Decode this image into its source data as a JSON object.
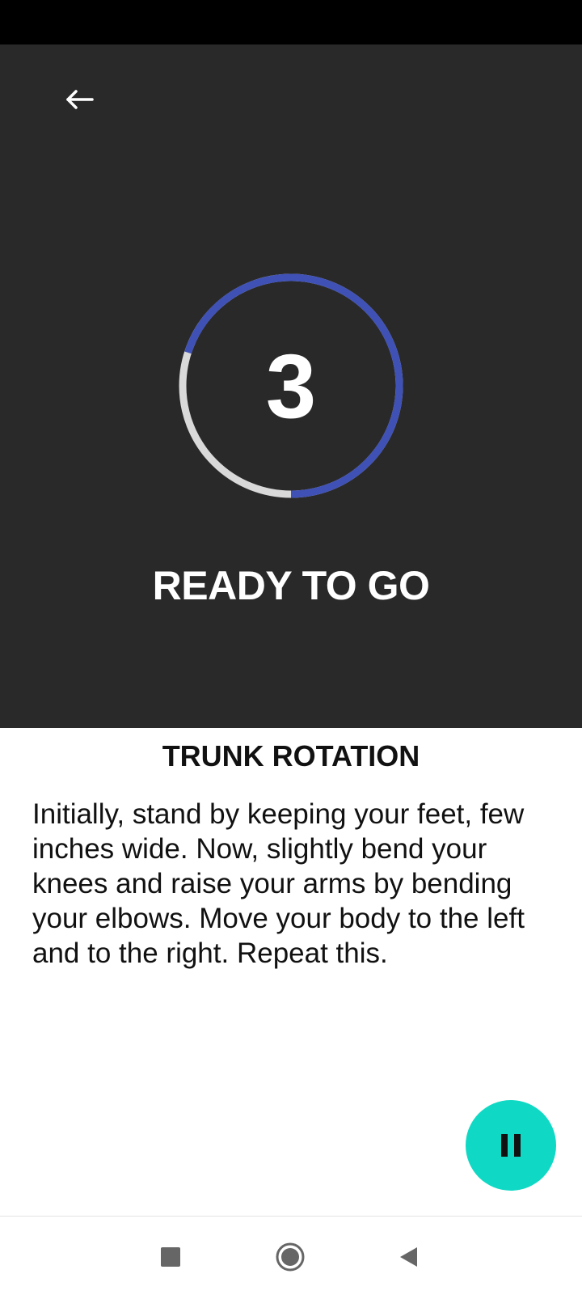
{
  "header": {
    "back_icon": "arrow-left-icon"
  },
  "timer": {
    "countdown": "3",
    "progress": 0.7,
    "progress_color": "#3f51b5",
    "track_color": "#d9d9d9",
    "status_label": "READY TO GO"
  },
  "exercise": {
    "title": "TRUNK ROTATION",
    "description": "Initially, stand by keeping your feet, few inches wide. Now, slightly bend your knees and raise your arms by bending your elbows. Move your body to the left and to the right. Repeat this."
  },
  "controls": {
    "pause_icon": "pause-icon",
    "accent_color": "#0fd9c4"
  },
  "navigation_bar": {
    "buttons": [
      "recents-square-icon",
      "home-circle-icon",
      "back-triangle-icon"
    ]
  }
}
